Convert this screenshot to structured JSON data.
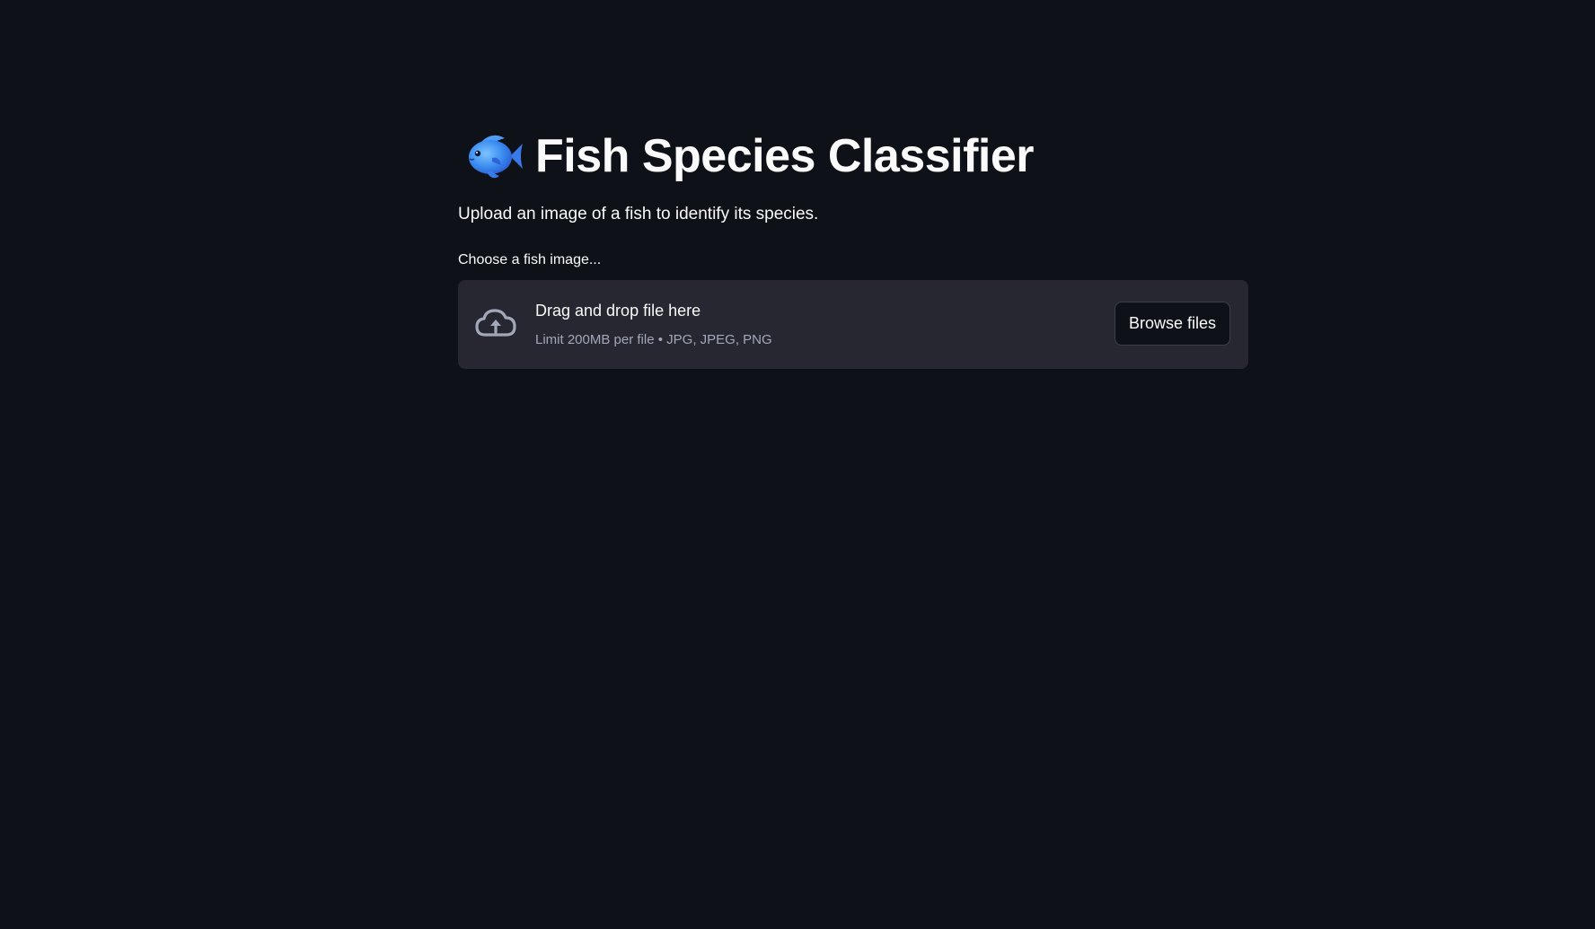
{
  "header": {
    "icon": "fish-emoji-icon",
    "title": "Fish Species Classifier",
    "subtitle": "Upload an image of a fish to identify its species."
  },
  "uploader": {
    "label": "Choose a fish image...",
    "icon": "cloud-upload-icon",
    "drop_title": "Drag and drop file here",
    "drop_subtitle": "Limit 200MB per file • JPG, JPEG, PNG",
    "browse_label": "Browse files"
  },
  "colors": {
    "background": "#0e1117",
    "panel": "#262730",
    "text": "#fafafa",
    "muted_text": "#a3a8b8",
    "fish_blue": "#3b82f6"
  }
}
